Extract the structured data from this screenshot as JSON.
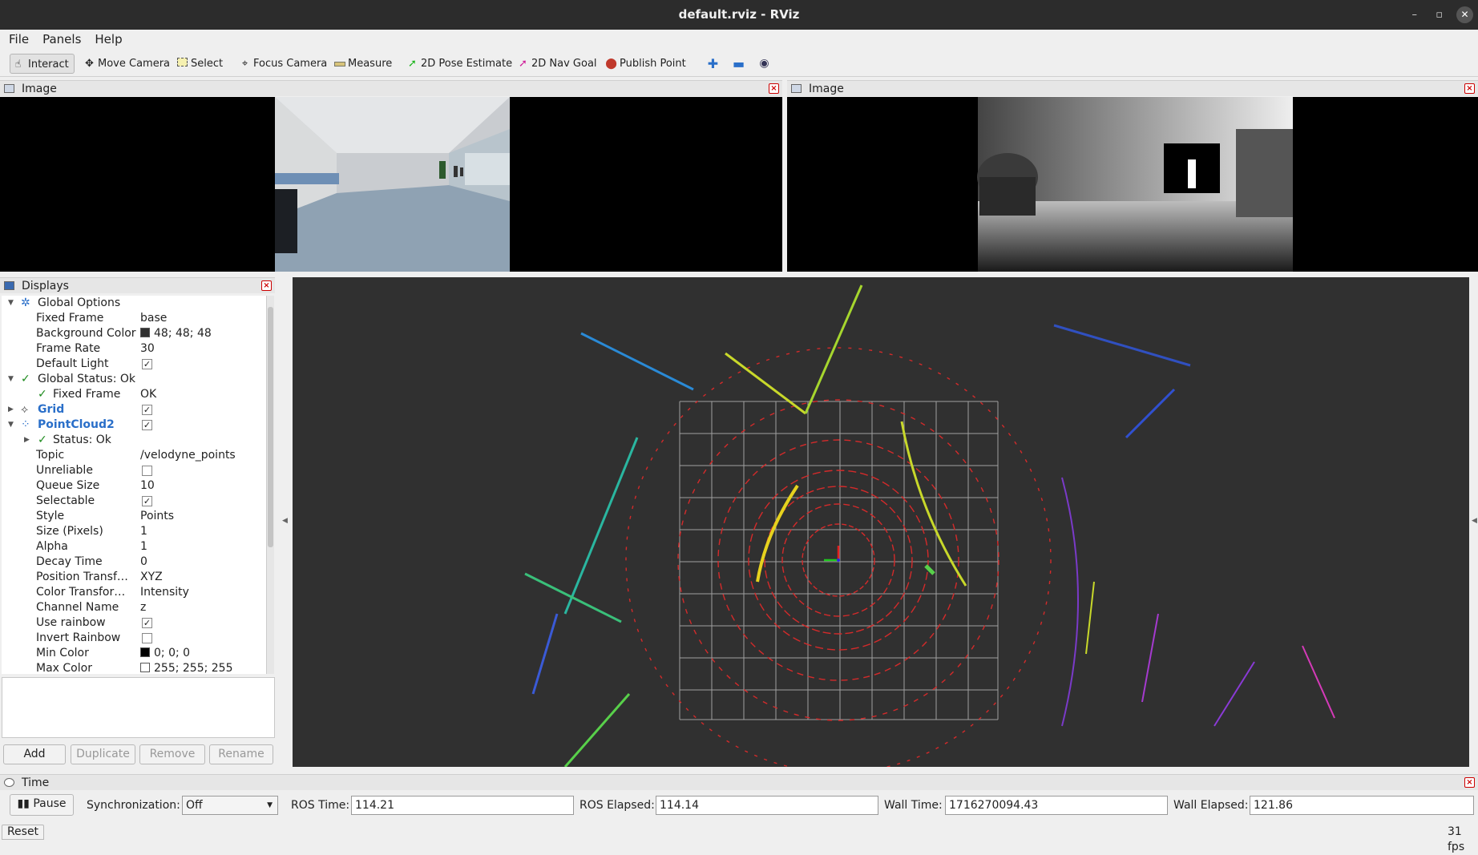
{
  "window": {
    "title": "default.rviz - RViz",
    "min": "–",
    "restore": "▫",
    "close": "✕"
  },
  "menu": [
    "File",
    "Panels",
    "Help"
  ],
  "toolbar": {
    "interact": "Interact",
    "move_camera": "Move Camera",
    "select": "Select",
    "focus_camera": "Focus Camera",
    "measure": "Measure",
    "pose_estimate": "2D Pose Estimate",
    "nav_goal": "2D Nav Goal",
    "publish_point": "Publish Point"
  },
  "image_panels": [
    {
      "title": "Image"
    },
    {
      "title": "Image"
    }
  ],
  "displays": {
    "title": "Displays",
    "rows": [
      {
        "label": "Global Options",
        "value": ""
      },
      {
        "label": "Fixed Frame",
        "value": "base"
      },
      {
        "label": "Background Color",
        "value": "48; 48; 48"
      },
      {
        "label": "Frame Rate",
        "value": "30"
      },
      {
        "label": "Default Light",
        "value": ""
      },
      {
        "label": "Global Status: Ok",
        "value": ""
      },
      {
        "label": "Fixed Frame",
        "value": "OK"
      },
      {
        "label": "Grid",
        "value": ""
      },
      {
        "label": "PointCloud2",
        "value": ""
      },
      {
        "label": "Status: Ok",
        "value": ""
      },
      {
        "label": "Topic",
        "value": "/velodyne_points"
      },
      {
        "label": "Unreliable",
        "value": ""
      },
      {
        "label": "Queue Size",
        "value": "10"
      },
      {
        "label": "Selectable",
        "value": ""
      },
      {
        "label": "Style",
        "value": "Points"
      },
      {
        "label": "Size (Pixels)",
        "value": "1"
      },
      {
        "label": "Alpha",
        "value": "1"
      },
      {
        "label": "Decay Time",
        "value": "0"
      },
      {
        "label": "Position Transf…",
        "value": "XYZ"
      },
      {
        "label": "Color Transfor…",
        "value": "Intensity"
      },
      {
        "label": "Channel Name",
        "value": "z"
      },
      {
        "label": "Use rainbow",
        "value": ""
      },
      {
        "label": "Invert Rainbow",
        "value": ""
      },
      {
        "label": "Min Color",
        "value": "0; 0; 0"
      },
      {
        "label": "Max Color",
        "value": "255; 255; 255"
      }
    ],
    "checks": {
      "default_light": true,
      "grid": true,
      "pointcloud2": true,
      "unreliable": false,
      "selectable": true,
      "use_rainbow": true,
      "invert_rainbow": false
    },
    "buttons": {
      "add": "Add",
      "duplicate": "Duplicate",
      "remove": "Remove",
      "rename": "Rename"
    }
  },
  "time": {
    "title": "Time",
    "pause": "Pause",
    "sync_label": "Synchronization:",
    "sync_value": "Off",
    "ros_time_label": "ROS Time:",
    "ros_time": "114.21",
    "ros_elapsed_label": "ROS Elapsed:",
    "ros_elapsed": "114.14",
    "wall_time_label": "Wall Time:",
    "wall_time": "1716270094.43",
    "wall_elapsed_label": "Wall Elapsed:",
    "wall_elapsed": "121.86",
    "reset": "Reset",
    "fps": "31 fps"
  },
  "colors": {
    "background_3d": "#303030",
    "grid": "#a0a0a0",
    "accent_blue": "#2a6fc9",
    "status_green": "#1c8a1c"
  }
}
